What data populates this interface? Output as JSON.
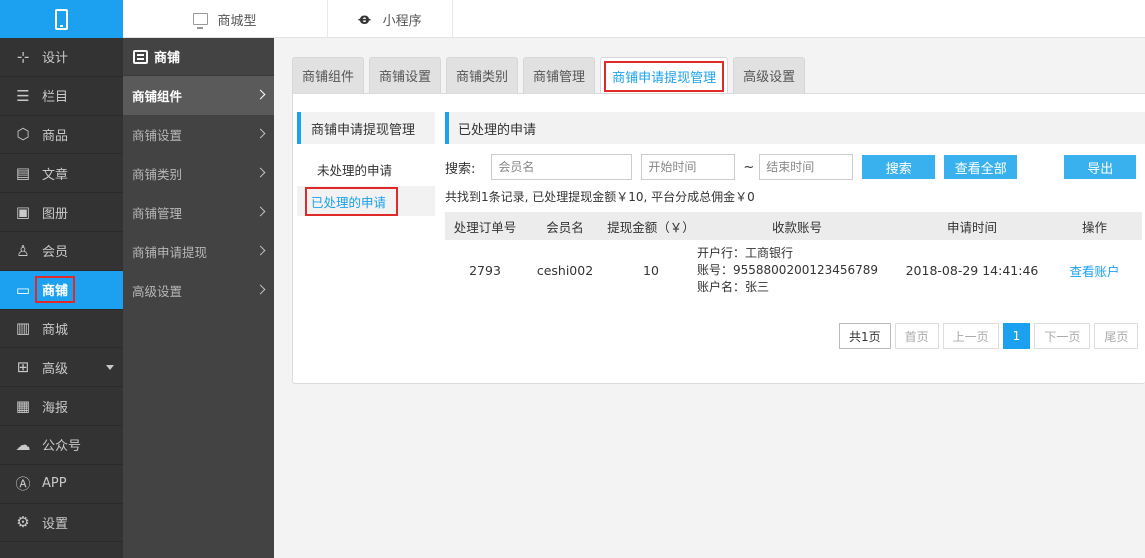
{
  "topbar": {
    "tabs": [
      {
        "label": "商城型",
        "icon": "monitor-icon"
      },
      {
        "label": "小程序",
        "icon": "mini-program-icon"
      }
    ]
  },
  "sidebar": {
    "items": [
      {
        "label": "设计",
        "icon": "design-icon"
      },
      {
        "label": "栏目",
        "icon": "list-icon"
      },
      {
        "label": "商品",
        "icon": "box-icon"
      },
      {
        "label": "文章",
        "icon": "article-icon"
      },
      {
        "label": "图册",
        "icon": "image-icon"
      },
      {
        "label": "会员",
        "icon": "user-icon"
      },
      {
        "label": "商铺",
        "icon": "store-icon",
        "active": true
      },
      {
        "label": "商城",
        "icon": "clipboard-icon"
      },
      {
        "label": "高级",
        "icon": "grid-icon"
      },
      {
        "label": "海报",
        "icon": "poster-icon"
      },
      {
        "label": "公众号",
        "icon": "wechat-icon"
      },
      {
        "label": "APP",
        "icon": "app-icon"
      },
      {
        "label": "设置",
        "icon": "gear-icon"
      }
    ]
  },
  "subnav": {
    "title": "商铺",
    "items": [
      "商铺组件",
      "商铺设置",
      "商铺类别",
      "商铺管理",
      "商铺申请提现",
      "高级设置"
    ]
  },
  "tabs": [
    "商铺组件",
    "商铺设置",
    "商铺类别",
    "商铺管理",
    "商铺申请提现管理",
    "高级设置"
  ],
  "side_panel": {
    "title": "商铺申请提现管理",
    "items": [
      "未处理的申请",
      "已处理的申请"
    ]
  },
  "panel": {
    "title": "已处理的申请",
    "search_label": "搜索:",
    "member_placeholder": "会员名",
    "start_placeholder": "开始时间",
    "tilde": "~",
    "end_placeholder": "结束时间",
    "search_button": "搜索",
    "view_all_button": "查看全部",
    "export_button": "导出",
    "summary": "共找到1条记录, 已处理提现金额￥10, 平台分成总佣金￥0"
  },
  "table": {
    "headers": [
      "处理订单号",
      "会员名",
      "提现金额（￥）",
      "收款账号",
      "申请时间",
      "操作"
    ],
    "rows": [
      {
        "order_no": "2793",
        "member": "ceshi002",
        "amount": "10",
        "bank": "开户行：工商银行",
        "account": "账号：9558800200123456789",
        "account_name": "账户名：张三",
        "time": "2018-08-29 14:41:46",
        "action": "查看账户"
      }
    ]
  },
  "pager": {
    "total": "共1页",
    "first": "首页",
    "prev": "上一页",
    "current": "1",
    "next": "下一页",
    "last": "尾页"
  },
  "colors": {
    "accent": "#1ba1ef",
    "highlight_border": "#e02a2a",
    "sidebar_bg": "#333333",
    "subnav_bg": "#434343"
  }
}
